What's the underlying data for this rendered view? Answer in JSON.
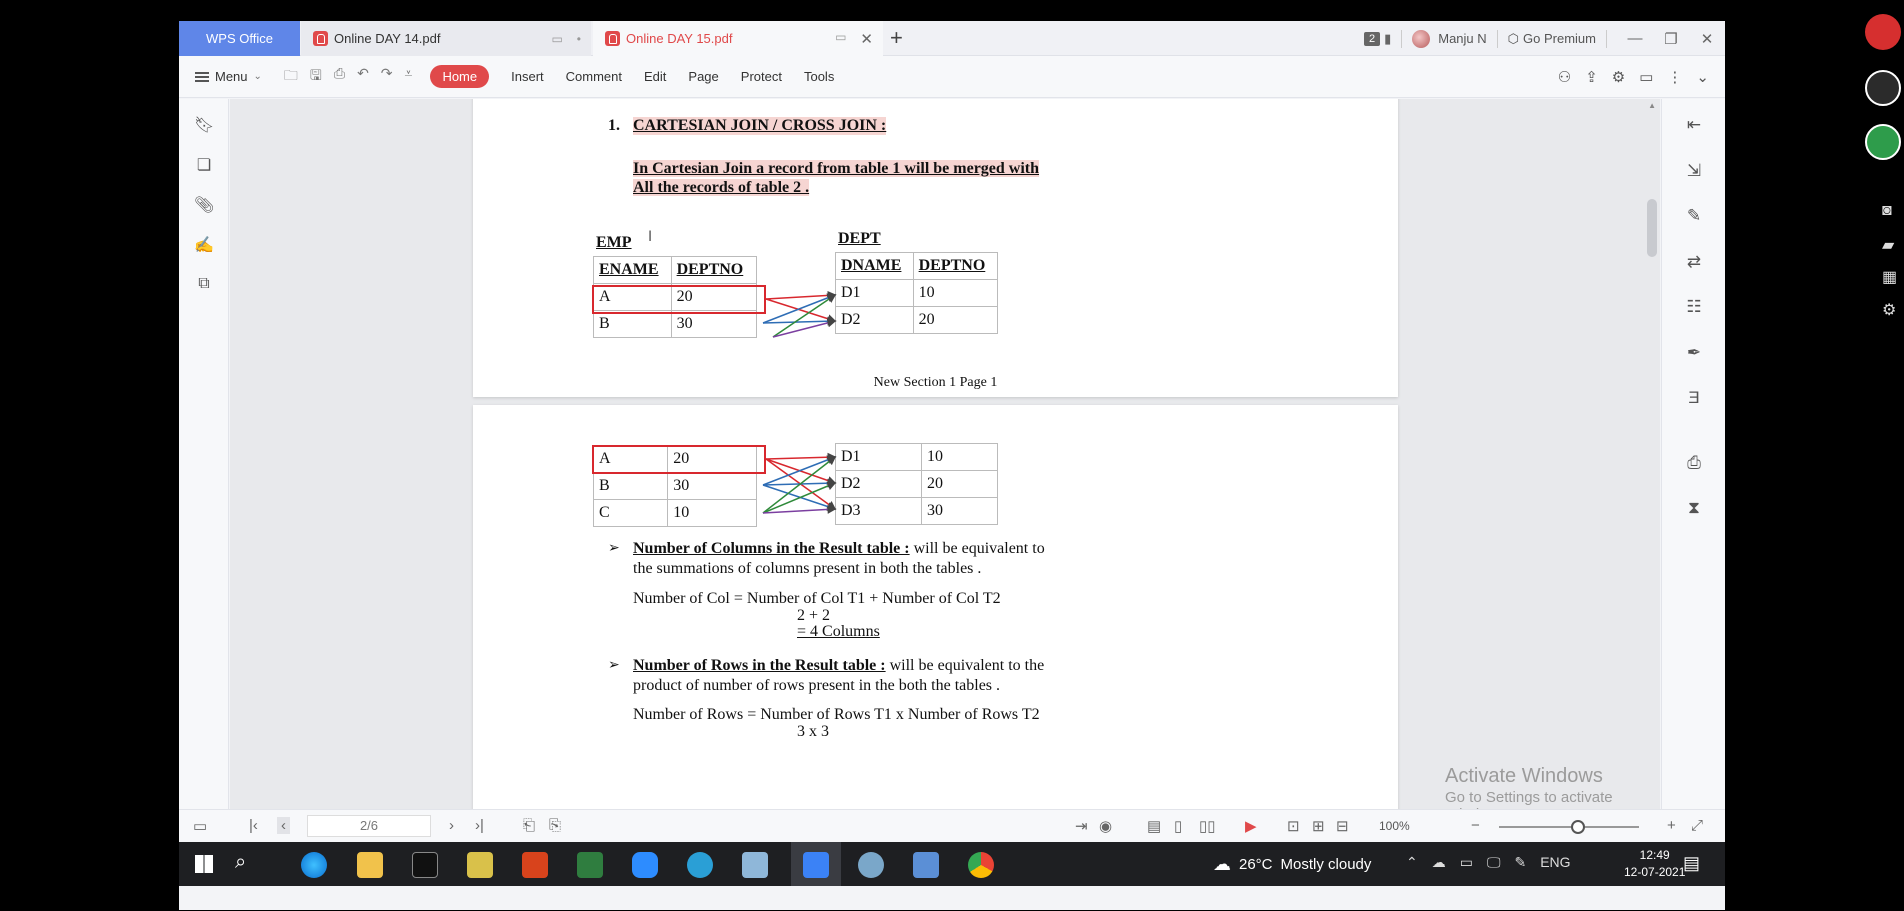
{
  "titlebar": {
    "app_tab": "WPS Office",
    "tabs": [
      {
        "label": "Online DAY 14.pdf"
      },
      {
        "label": "Online DAY 15.pdf"
      }
    ],
    "window_count": "2",
    "user_name": "Manju N",
    "premium_label": "Go Premium"
  },
  "ribbon": {
    "menu_label": "Menu",
    "tabs": [
      "Home",
      "Insert",
      "Comment",
      "Edit",
      "Page",
      "Protect",
      "Tools"
    ]
  },
  "doc": {
    "heading_num": "1.",
    "heading": "CARTESIAN JOIN / CROSS JOIN :",
    "intro_line1": "In Cartesian Join a record from table 1 will be merged with",
    "intro_line2": "All the records of table 2 .",
    "emp_label": "EMP",
    "dept_label": "DEPT",
    "emp_headers": [
      "ENAME",
      "DEPTNO"
    ],
    "emp_rows_p1": [
      [
        "A",
        "20"
      ],
      [
        "B",
        "30"
      ]
    ],
    "dept_headers": [
      "DNAME",
      "DEPTNO"
    ],
    "dept_rows_p1": [
      [
        "D1",
        "10"
      ],
      [
        "D2",
        "20"
      ]
    ],
    "page_footer": "New Section 1 Page 1",
    "emp_rows_p2": [
      [
        "A",
        "20"
      ],
      [
        "B",
        "30"
      ],
      [
        "C",
        "10"
      ]
    ],
    "dept_rows_p2": [
      [
        "D1",
        "10"
      ],
      [
        "D2",
        "20"
      ],
      [
        "D3",
        "30"
      ]
    ],
    "cols_title": "Number of Columns in the Result table :",
    "cols_rest": " will be equivalent to",
    "cols_line2": "the summations of columns present in both the tables .",
    "cols_formula": "Number of Col  = Number of Col T1 + Number of Col T2",
    "cols_calc1": "2 + 2",
    "cols_calc2": "= 4 Columns",
    "rows_title": "Number of Rows in the Result table :",
    "rows_rest": " will be equivalent to the",
    "rows_line2": "product of number of rows present in the both the tables .",
    "rows_formula": "Number of Rows = Number of Rows T1  x  Number of Rows T2",
    "rows_calc1": "3 x 3"
  },
  "watermark": {
    "line1": "Activate Windows",
    "line2": "Go to Settings to activate Windows."
  },
  "statusbar": {
    "page_value": "2/6",
    "zoom": "100%"
  },
  "taskbar": {
    "temperature": "26°C",
    "weather": "Mostly cloudy",
    "language": "ENG",
    "time": "12:49",
    "date": "12-07-2021"
  }
}
